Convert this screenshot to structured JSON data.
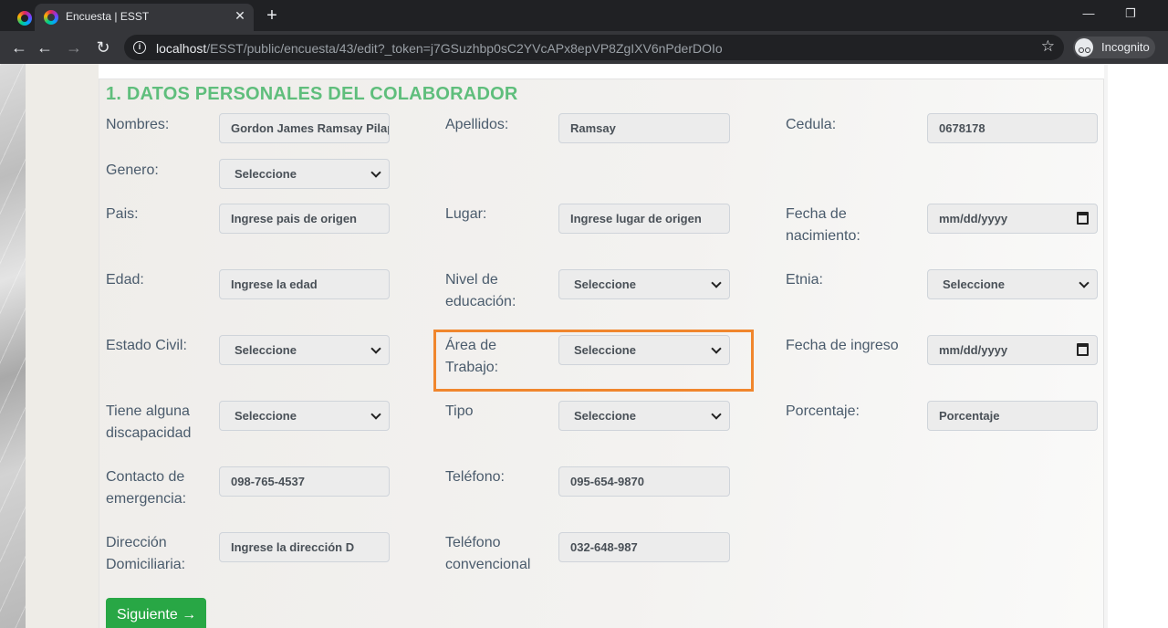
{
  "browser": {
    "tab_title": "Encuesta | ESST",
    "tab_close": "✕",
    "new_tab": "+",
    "window_controls": {
      "minimize": "—",
      "restore": "❐"
    },
    "nav": {
      "back": "←",
      "forward": "→",
      "reload": "↻"
    },
    "url_host": "localhost",
    "url_path": "/ESST/public/encuesta/43/edit?_token=j7GSuzhbp0sC2YVcAPx8epVP8ZgIXV6nPderDOIo",
    "star": "☆",
    "incognito_label": "Incognito"
  },
  "form": {
    "section_title": "1. DATOS PERSONALES DEL COLABORADOR",
    "labels": {
      "nombres": "Nombres:",
      "apellidos": "Apellidos:",
      "cedula": "Cedula:",
      "genero": "Genero:",
      "pais": "Pais:",
      "lugar": "Lugar:",
      "fecha_nacimiento": "Fecha de nacimiento:",
      "edad": "Edad:",
      "nivel_educacion": "Nivel de educación:",
      "etnia": "Etnia:",
      "estado_civil": "Estado Civil:",
      "area_trabajo": "Área de Trabajo:",
      "fecha_ingreso": "Fecha de ingreso",
      "discapacidad": "Tiene alguna discapacidad",
      "tipo": "Tipo",
      "porcentaje": "Porcentaje:",
      "contacto_emergencia": "Contacto de emergencia:",
      "telefono": "Teléfono:",
      "direccion": "Dirección Domiciliaria:",
      "telefono_convencional": "Teléfono convencional"
    },
    "values": {
      "nombres": "Gordon James Ramsay Pilapaña",
      "apellidos": "Ramsay",
      "cedula": "0678178",
      "genero": "Seleccione",
      "pais": "Ingrese pais de origen",
      "lugar": "Ingrese lugar de origen",
      "fecha_nacimiento": "mm/dd/yyyy",
      "edad": "Ingrese la edad",
      "nivel_educacion": "Seleccione",
      "etnia": "Seleccione",
      "estado_civil": "Seleccione",
      "area_trabajo": "Seleccione",
      "fecha_ingreso": "mm/dd/yyyy",
      "discapacidad": "Seleccione",
      "tipo": "Seleccione",
      "porcentaje": "Porcentaje",
      "contacto_emergencia": "098-765-4537",
      "telefono": "095-654-9870",
      "direccion": "Ingrese la dirección D",
      "telefono_convencional": "032-648-987"
    },
    "next_button": "Siguiente →"
  },
  "colors": {
    "title_green": "#5fbe7c",
    "button_green": "#28a745",
    "highlight_orange": "#f0862d"
  }
}
